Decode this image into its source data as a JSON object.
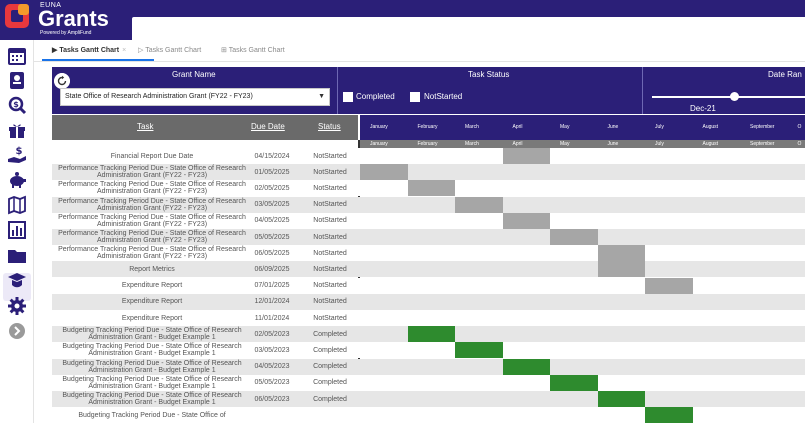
{
  "header": {
    "brand_small": "EUNA",
    "brand_main": "Grants",
    "brand_sub": "Powered by AmpliFund"
  },
  "sidebar": {
    "items": [
      {
        "icon": "calendar-icon"
      },
      {
        "icon": "contact-card-icon"
      },
      {
        "icon": "search-dollar-icon"
      },
      {
        "icon": "gift-icon"
      },
      {
        "icon": "hand-dollar-icon"
      },
      {
        "icon": "piggy-bank-icon"
      },
      {
        "icon": "map-icon"
      },
      {
        "icon": "bar-chart-icon",
        "active": true
      },
      {
        "icon": "folder-icon"
      },
      {
        "icon": "graduation-icon"
      },
      {
        "icon": "gear-icon"
      },
      {
        "icon": "arrow-right-circle-icon"
      }
    ]
  },
  "tabs": [
    {
      "label": "Tasks Gantt Chart",
      "active": true,
      "close": "×"
    },
    {
      "label": "Tasks Gantt Chart",
      "active": false
    },
    {
      "label": "Tasks Gantt Chart",
      "active": false
    }
  ],
  "filters": {
    "grant_name_header": "Grant Name",
    "task_status_header": "Task Status",
    "date_range_header": "Date Ran",
    "grant_selected": "State Office of Research Administration Grant (FY22 - FY23)",
    "status_options": [
      "Completed",
      "NotStarted"
    ],
    "date_value": "Dec-21"
  },
  "columns": {
    "task": "Task",
    "due_date": "Due Date",
    "status": "Status"
  },
  "months": [
    "January",
    "February",
    "March",
    "April",
    "May",
    "June",
    "July",
    "August",
    "September",
    "O"
  ],
  "colors": {
    "navy": "#2b1f78",
    "gray_bar": "#a6a6a6",
    "green_bar": "#2e8b2e"
  },
  "rows": [
    {
      "task": "Financial Report Due Date",
      "due": "04/15/2024",
      "status": "NotStarted",
      "bar_month": 3
    },
    {
      "task": "Performance Tracking Period Due - State Office of Research Administration Grant (FY22 - FY23)",
      "due": "01/05/2025",
      "status": "NotStarted",
      "bar_month": 0
    },
    {
      "task": "Performance Tracking Period Due - State Office of Research Administration Grant (FY22 - FY23)",
      "due": "02/05/2025",
      "status": "NotStarted",
      "bar_month": 1
    },
    {
      "task": "Performance Tracking Period Due - State Office of Research Administration Grant (FY22 - FY23)",
      "due": "03/05/2025",
      "status": "NotStarted",
      "bar_month": 2
    },
    {
      "task": "Performance Tracking Period Due - State Office of Research Administration Grant (FY22 - FY23)",
      "due": "04/05/2025",
      "status": "NotStarted",
      "bar_month": 3
    },
    {
      "task": "Performance Tracking Period Due - State Office of Research Administration Grant (FY22 - FY23)",
      "due": "05/05/2025",
      "status": "NotStarted",
      "bar_month": 4
    },
    {
      "task": "Performance Tracking Period Due - State Office of Research Administration Grant (FY22 - FY23)",
      "due": "06/05/2025",
      "status": "NotStarted",
      "bar_month": 5
    },
    {
      "task": "Report Metrics",
      "due": "06/09/2025",
      "status": "NotStarted",
      "bar_month": 5
    },
    {
      "task": "Expenditure Report",
      "due": "07/01/2025",
      "status": "NotStarted",
      "bar_month": 6
    },
    {
      "task": "Expenditure Report",
      "due": "12/01/2024",
      "status": "NotStarted",
      "bar_month": null
    },
    {
      "task": "Expenditure Report",
      "due": "11/01/2024",
      "status": "NotStarted",
      "bar_month": null
    },
    {
      "task": "Budgeting Tracking Period Due - State Office of Research Administration Grant - Budget Example 1",
      "due": "02/05/2023",
      "status": "Completed",
      "bar_month": 1
    },
    {
      "task": "Budgeting Tracking Period Due - State Office of Research Administration Grant - Budget Example 1",
      "due": "03/05/2023",
      "status": "Completed",
      "bar_month": 2
    },
    {
      "task": "Budgeting Tracking Period Due - State Office of Research Administration Grant - Budget Example 1",
      "due": "04/05/2023",
      "status": "Completed",
      "bar_month": 3
    },
    {
      "task": "Budgeting Tracking Period Due - State Office of Research Administration Grant - Budget Example 1",
      "due": "05/05/2023",
      "status": "Completed",
      "bar_month": 4
    },
    {
      "task": "Budgeting Tracking Period Due - State Office of Research Administration Grant - Budget Example 1",
      "due": "06/05/2023",
      "status": "Completed",
      "bar_month": 5
    },
    {
      "task": "Budgeting Tracking Period Due - State Office of",
      "due": "",
      "status": "",
      "bar_month": 6
    }
  ]
}
